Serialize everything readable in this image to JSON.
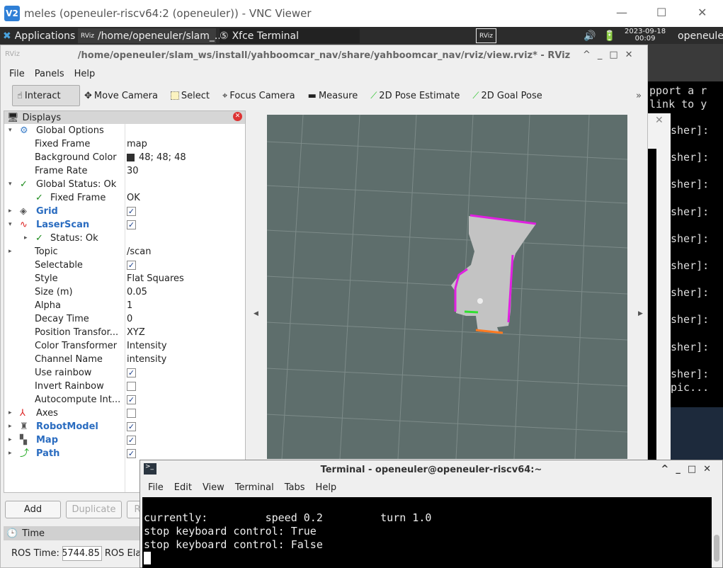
{
  "vnc": {
    "title": "meles (openeuler-riscv64:2 (openeuler)) - VNC Viewer",
    "logo": "V2"
  },
  "taskbar": {
    "applications": "Applications",
    "task1": "/home/openeuler/slam_...",
    "task2": "Xfce Terminal",
    "date": "2023-09-18",
    "time": "00:09",
    "user": "openeuler"
  },
  "rviz": {
    "title": "/home/openeuler/slam_ws/install/yahboomcar_nav/share/yahboomcar_nav/rviz/view.rviz* - RViz",
    "menu": [
      "File",
      "Panels",
      "Help"
    ],
    "tools": [
      "Interact",
      "Move Camera",
      "Select",
      "Focus Camera",
      "Measure",
      "2D Pose Estimate",
      "2D Goal Pose"
    ],
    "displays_title": "Displays",
    "rows": [
      {
        "label": "Global Options",
        "value": ""
      },
      {
        "label": "Fixed Frame",
        "value": "map"
      },
      {
        "label": "Background Color",
        "value": "48; 48; 48"
      },
      {
        "label": "Frame Rate",
        "value": "30"
      },
      {
        "label": "Global Status: Ok",
        "value": ""
      },
      {
        "label": "Fixed Frame",
        "value": "OK"
      },
      {
        "label": "Grid",
        "value": ""
      },
      {
        "label": "LaserScan",
        "value": ""
      },
      {
        "label": "Status: Ok",
        "value": ""
      },
      {
        "label": "Topic",
        "value": "/scan"
      },
      {
        "label": "Selectable",
        "value": ""
      },
      {
        "label": "Style",
        "value": "Flat Squares"
      },
      {
        "label": "Size (m)",
        "value": "0.05"
      },
      {
        "label": "Alpha",
        "value": "1"
      },
      {
        "label": "Decay Time",
        "value": "0"
      },
      {
        "label": "Position Transfor...",
        "value": "XYZ"
      },
      {
        "label": "Color Transformer",
        "value": "Intensity"
      },
      {
        "label": "Channel Name",
        "value": "intensity"
      },
      {
        "label": "Use rainbow",
        "value": ""
      },
      {
        "label": "Invert Rainbow",
        "value": ""
      },
      {
        "label": "Autocompute Int...",
        "value": ""
      },
      {
        "label": "Axes",
        "value": ""
      },
      {
        "label": "RobotModel",
        "value": ""
      },
      {
        "label": "Map",
        "value": ""
      },
      {
        "label": "Path",
        "value": ""
      }
    ],
    "checkbox_states": {
      "Grid": true,
      "LaserScan": true,
      "Selectable": true,
      "Use rainbow": true,
      "Invert Rainbow": false,
      "Autocompute Int...": true,
      "Axes": false,
      "RobotModel": true,
      "Map": true,
      "Path": true
    },
    "background_color": "#303030",
    "buttons": {
      "add": "Add",
      "duplicate": "Duplicate",
      "remove": "R"
    },
    "time_title": "Time",
    "ros_time_label": "ROS Time:",
    "ros_time_value": "5744.85",
    "ros_elapsed_label": "ROS Ela"
  },
  "bgterm": {
    "lines": [
      "pport a r",
      "link to y",
      "sher]:",
      "sher]:",
      "sher]:",
      "sher]:",
      "sher]:",
      "sher]:",
      "sher]:",
      "sher]:",
      "sher]:",
      "sher]:",
      "pic..."
    ]
  },
  "terminal": {
    "title": "Terminal - openeuler@openeuler-riscv64:~",
    "menu": [
      "File",
      "Edit",
      "View",
      "Terminal",
      "Tabs",
      "Help"
    ],
    "lines": [
      "currently:\t speed 0.2\t turn 1.0",
      "stop keyboard control: True",
      "stop keyboard control: False"
    ]
  }
}
